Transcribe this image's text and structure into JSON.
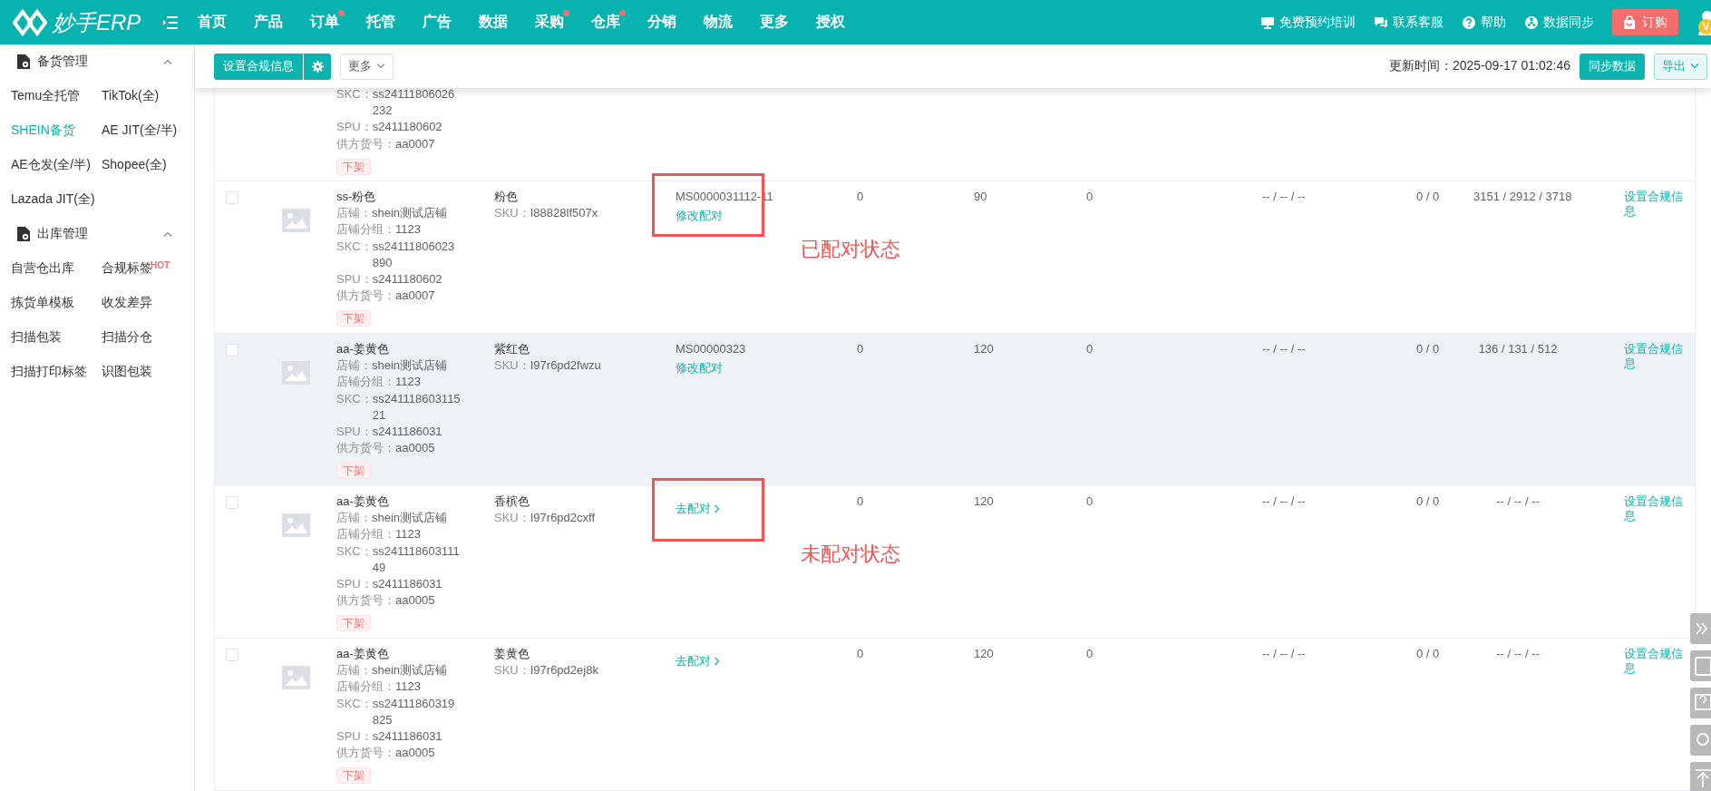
{
  "header": {
    "logo": "妙手ERP",
    "nav": [
      {
        "label": "首页",
        "dot": false
      },
      {
        "label": "产品",
        "dot": false
      },
      {
        "label": "订单",
        "dot": true
      },
      {
        "label": "托管",
        "dot": false
      },
      {
        "label": "广告",
        "dot": false
      },
      {
        "label": "数据",
        "dot": false
      },
      {
        "label": "采购",
        "dot": true
      },
      {
        "label": "仓库",
        "dot": true
      },
      {
        "label": "分销",
        "dot": false
      },
      {
        "label": "物流",
        "dot": false
      },
      {
        "label": "更多",
        "dot": false
      },
      {
        "label": "授权",
        "dot": false
      }
    ],
    "links": [
      {
        "kind": "training",
        "label": "免费预约培训"
      },
      {
        "kind": "service",
        "label": "联系客服"
      },
      {
        "kind": "help",
        "label": "帮助"
      },
      {
        "kind": "sync",
        "label": "数据同步"
      }
    ],
    "order_button": "订购",
    "avatar_badge": "V"
  },
  "sidebar": {
    "groups": [
      {
        "title": "备货管理",
        "expanded": true,
        "items": [
          {
            "label": "Temu全托管",
            "selected": false
          },
          {
            "label": "TikTok(全)",
            "selected": false
          },
          {
            "label": "SHEIN备货",
            "selected": true
          },
          {
            "label": "AE JIT(全/半)",
            "selected": false
          },
          {
            "label": "AE仓发(全/半)",
            "selected": false
          },
          {
            "label": "Shopee(全)",
            "selected": false
          },
          {
            "label": "Lazada JIT(全)",
            "selected": false
          }
        ]
      },
      {
        "title": "出库管理",
        "expanded": true,
        "items": [
          {
            "label": "自营仓出库",
            "selected": false
          },
          {
            "label": "合规标签",
            "selected": false,
            "badge": "HOT"
          },
          {
            "label": "拣货单模板",
            "selected": false
          },
          {
            "label": "收发差异",
            "selected": false
          },
          {
            "label": "扫描包装",
            "selected": false
          },
          {
            "label": "扫描分仓",
            "selected": false
          },
          {
            "label": "扫描打印标签",
            "selected": false
          },
          {
            "label": "识图包装",
            "selected": false
          }
        ]
      }
    ]
  },
  "toolbar": {
    "compliance_button": "设置合规信息",
    "more_dropdown": "更多",
    "update_time": "更新时间：2025-09-17 01:02:46",
    "sync_button": "同步数据",
    "export_dropdown": "导出"
  },
  "rows": [
    {
      "kind": "partial",
      "details": [
        {
          "label": "SKC：",
          "value": "ss24111806026232"
        },
        {
          "label": "SPU：",
          "value": "s2411180602"
        },
        {
          "label": "供方货号：",
          "value": "aa0007"
        }
      ],
      "tag": "下架"
    },
    {
      "kind": "full",
      "checked": false,
      "highlighted": false,
      "title": "ss-粉色",
      "details": [
        {
          "label": "店铺：",
          "value": "shein测试店铺"
        },
        {
          "label": "店铺分组：",
          "value": "1123"
        },
        {
          "label": "SKC：",
          "value": "ss24111806023890"
        },
        {
          "label": "SPU：",
          "value": "s2411180602"
        },
        {
          "label": "供方货号：",
          "value": "aa0007"
        }
      ],
      "tag": "下架",
      "color_name": "粉色",
      "sku": {
        "label": "SKU：",
        "value": "I88828lf507x"
      },
      "match": {
        "kind": "paired",
        "code": "MS0000031112-11",
        "action": "修改配对"
      },
      "metrics": [
        "0",
        "90",
        "0",
        "-- / -- / --",
        "0 / 0",
        "3151 / 2912 / 3718"
      ],
      "action": "设置合规信息",
      "annotation": "已配对状态"
    },
    {
      "kind": "full",
      "checked": false,
      "highlighted": true,
      "title": "aa-姜黄色",
      "details": [
        {
          "label": "店铺：",
          "value": "shein测试店铺"
        },
        {
          "label": "店铺分组：",
          "value": "1123"
        },
        {
          "label": "SKC：",
          "value": "ss24111860311521"
        },
        {
          "label": "SPU：",
          "value": "s2411186031"
        },
        {
          "label": "供方货号：",
          "value": "aa0005"
        }
      ],
      "tag": "下架",
      "color_name": "紫红色",
      "sku": {
        "label": "SKU：",
        "value": "I97r6pd2fwzu"
      },
      "match": {
        "kind": "paired",
        "code": "MS00000323",
        "action": "修改配对"
      },
      "metrics": [
        "0",
        "120",
        "0",
        "-- / -- / --",
        "0 / 0",
        "136 / 131 / 512"
      ],
      "action": "设置合规信息"
    },
    {
      "kind": "full",
      "checked": false,
      "highlighted": false,
      "title": "aa-姜黄色",
      "details": [
        {
          "label": "店铺：",
          "value": "shein测试店铺"
        },
        {
          "label": "店铺分组：",
          "value": "1123"
        },
        {
          "label": "SKC：",
          "value": "ss24111860311149"
        },
        {
          "label": "SPU：",
          "value": "s2411186031"
        },
        {
          "label": "供方货号：",
          "value": "aa0005"
        }
      ],
      "tag": "下架",
      "color_name": "香槟色",
      "sku": {
        "label": "SKU：",
        "value": "I97r6pd2cxff"
      },
      "match": {
        "kind": "unpaired",
        "action": "去配对"
      },
      "metrics": [
        "0",
        "120",
        "0",
        "-- / -- / --",
        "0 / 0",
        "-- / -- / --"
      ],
      "action": "设置合规信息",
      "annotation": "未配对状态"
    },
    {
      "kind": "full",
      "checked": false,
      "highlighted": false,
      "title": "aa-姜黄色",
      "details": [
        {
          "label": "店铺：",
          "value": "shein测试店铺"
        },
        {
          "label": "店铺分组：",
          "value": "1123"
        },
        {
          "label": "SKC：",
          "value": "ss24111860319825"
        },
        {
          "label": "SPU：",
          "value": "s2411186031"
        },
        {
          "label": "供方货号：",
          "value": "aa0005"
        }
      ],
      "tag": "下架",
      "color_name": "姜黄色",
      "sku": {
        "label": "SKU：",
        "value": "I97r6pd2ej8k"
      },
      "match": {
        "kind": "unpaired",
        "action": "去配对"
      },
      "metrics": [
        "0",
        "120",
        "0",
        "-- / -- / --",
        "0 / 0",
        "-- / -- / --"
      ],
      "action": "设置合规信息"
    }
  ]
}
